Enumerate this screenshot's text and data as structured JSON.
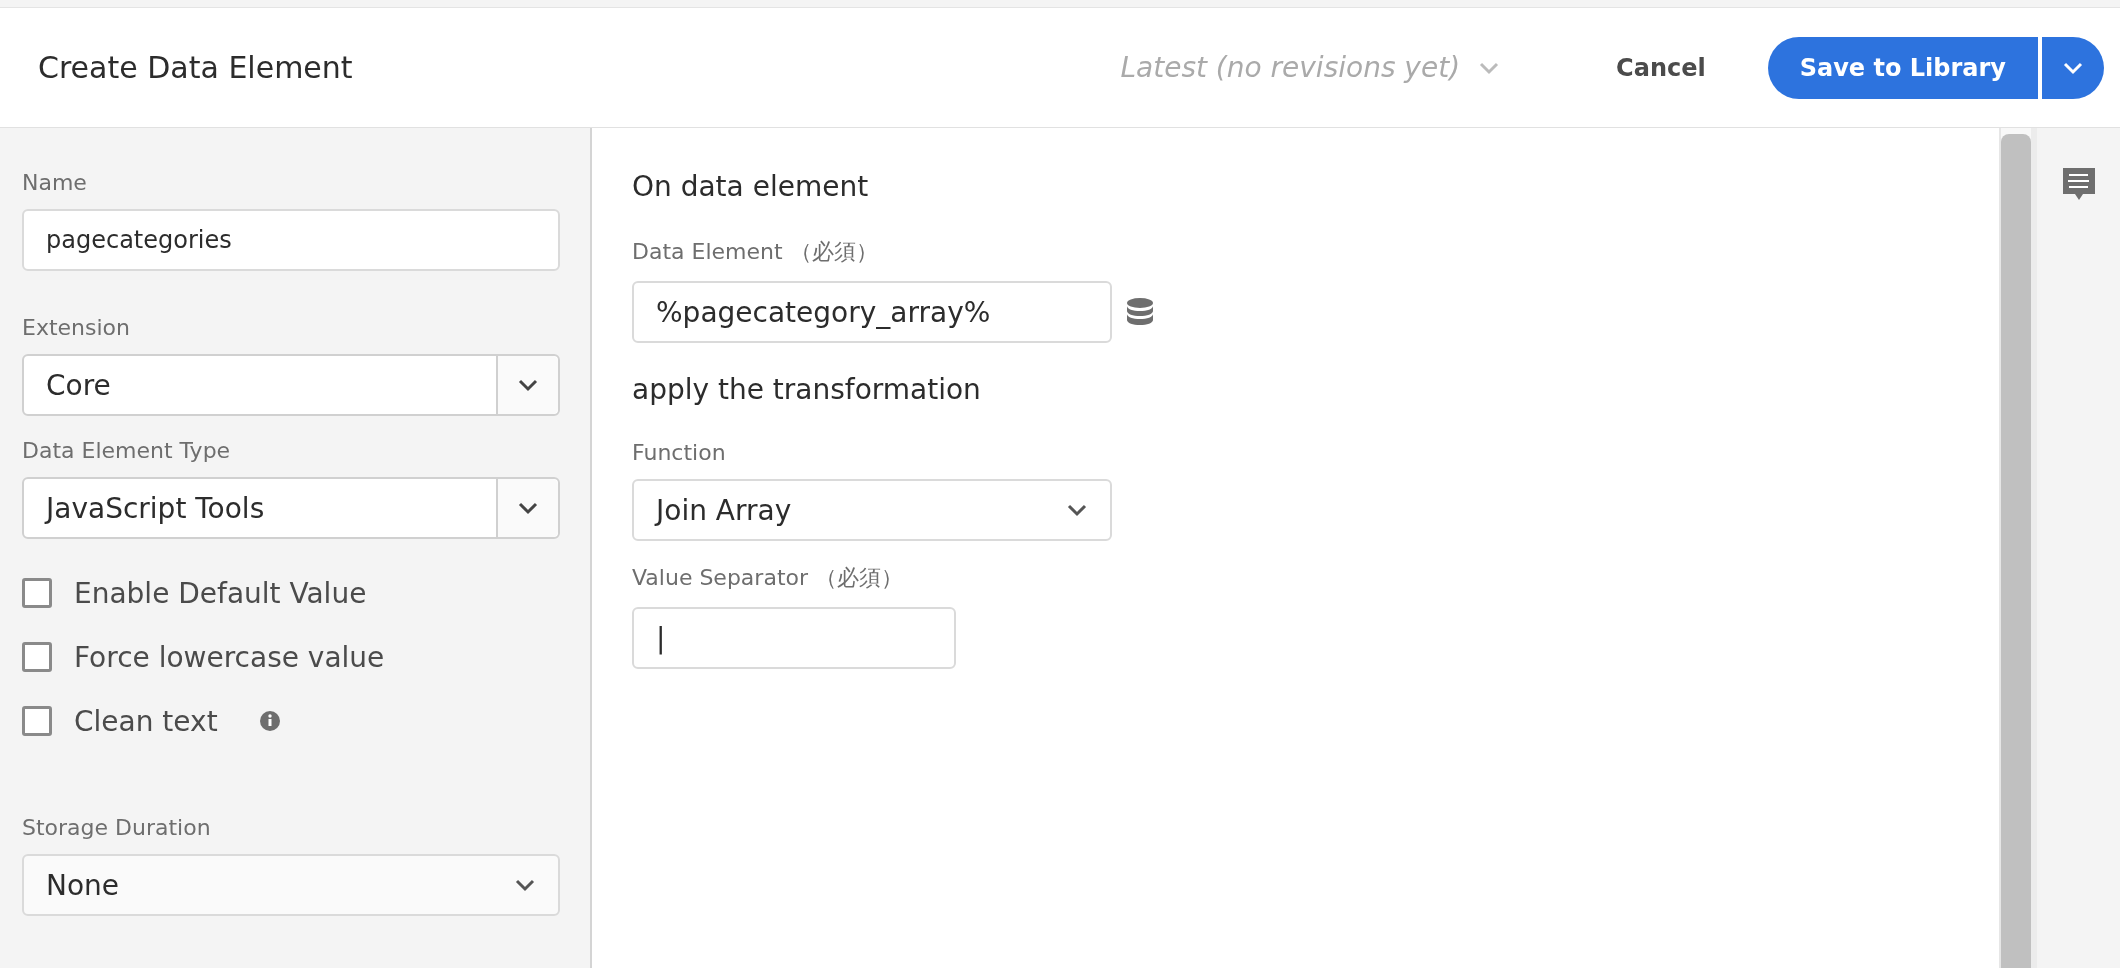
{
  "header": {
    "title": "Create Data Element",
    "revision": "Latest (no revisions yet)",
    "cancel": "Cancel",
    "save": "Save to Library"
  },
  "sidebar": {
    "fields": [
      {
        "kind": "input",
        "label": "Name",
        "value": "pagecategories"
      },
      {
        "kind": "select",
        "label": "Extension",
        "value": "Core"
      },
      {
        "kind": "select",
        "label": "Data Element Type",
        "value": "JavaScript Tools"
      },
      {
        "kind": "checkbox",
        "label": "Enable Default Value",
        "checked": false
      },
      {
        "kind": "checkbox",
        "label": "Force lowercase value",
        "checked": false
      },
      {
        "kind": "checkbox",
        "label": "Clean text",
        "checked": false,
        "info": true
      },
      {
        "kind": "dropdown",
        "label": "Storage Duration",
        "value": "None"
      }
    ]
  },
  "main": {
    "items": [
      {
        "kind": "heading",
        "text": "On data element"
      },
      {
        "kind": "input",
        "label": "Data Element （必須）",
        "value": "%pagecategory_array%",
        "picker": true
      },
      {
        "kind": "heading",
        "text": "apply the transformation"
      },
      {
        "kind": "dropdown",
        "label": "Function",
        "value": "Join Array"
      },
      {
        "kind": "input",
        "label": "Value Separator （必須）",
        "value": "|",
        "narrow": true
      }
    ]
  }
}
